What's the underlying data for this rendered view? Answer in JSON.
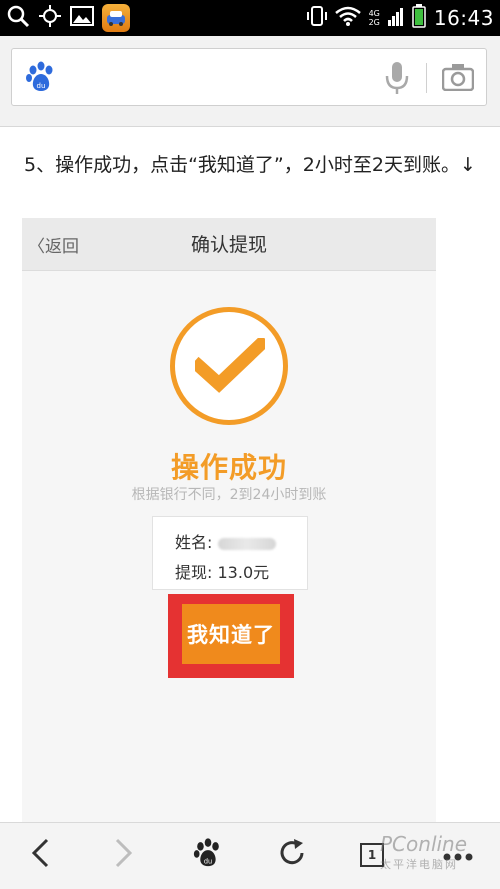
{
  "status_bar": {
    "time": "16:43",
    "network_top": "4G",
    "network_bottom": "2G"
  },
  "search": {
    "placeholder": ""
  },
  "article": {
    "step_text": "5、操作成功，点击“我知道了”，2小时至2天到账。↓"
  },
  "screenshot": {
    "back_label": "返回",
    "page_title": "确认提现",
    "success_title": "操作成功",
    "success_subtitle": "根据银行不同，2到24小时到账",
    "name_label": "姓名:",
    "amount_label": "提现:",
    "amount_value": "13.0元",
    "confirm_button": "我知道了"
  },
  "toolbar": {
    "tab_count": "1"
  },
  "watermark": {
    "brand": "PConline",
    "sub": "太平洋电脑网"
  },
  "colors": {
    "accent_orange": "#f39c27",
    "button_orange": "#f08a1c",
    "highlight_red": "#e53232",
    "baidu_blue": "#2e6bdc"
  }
}
